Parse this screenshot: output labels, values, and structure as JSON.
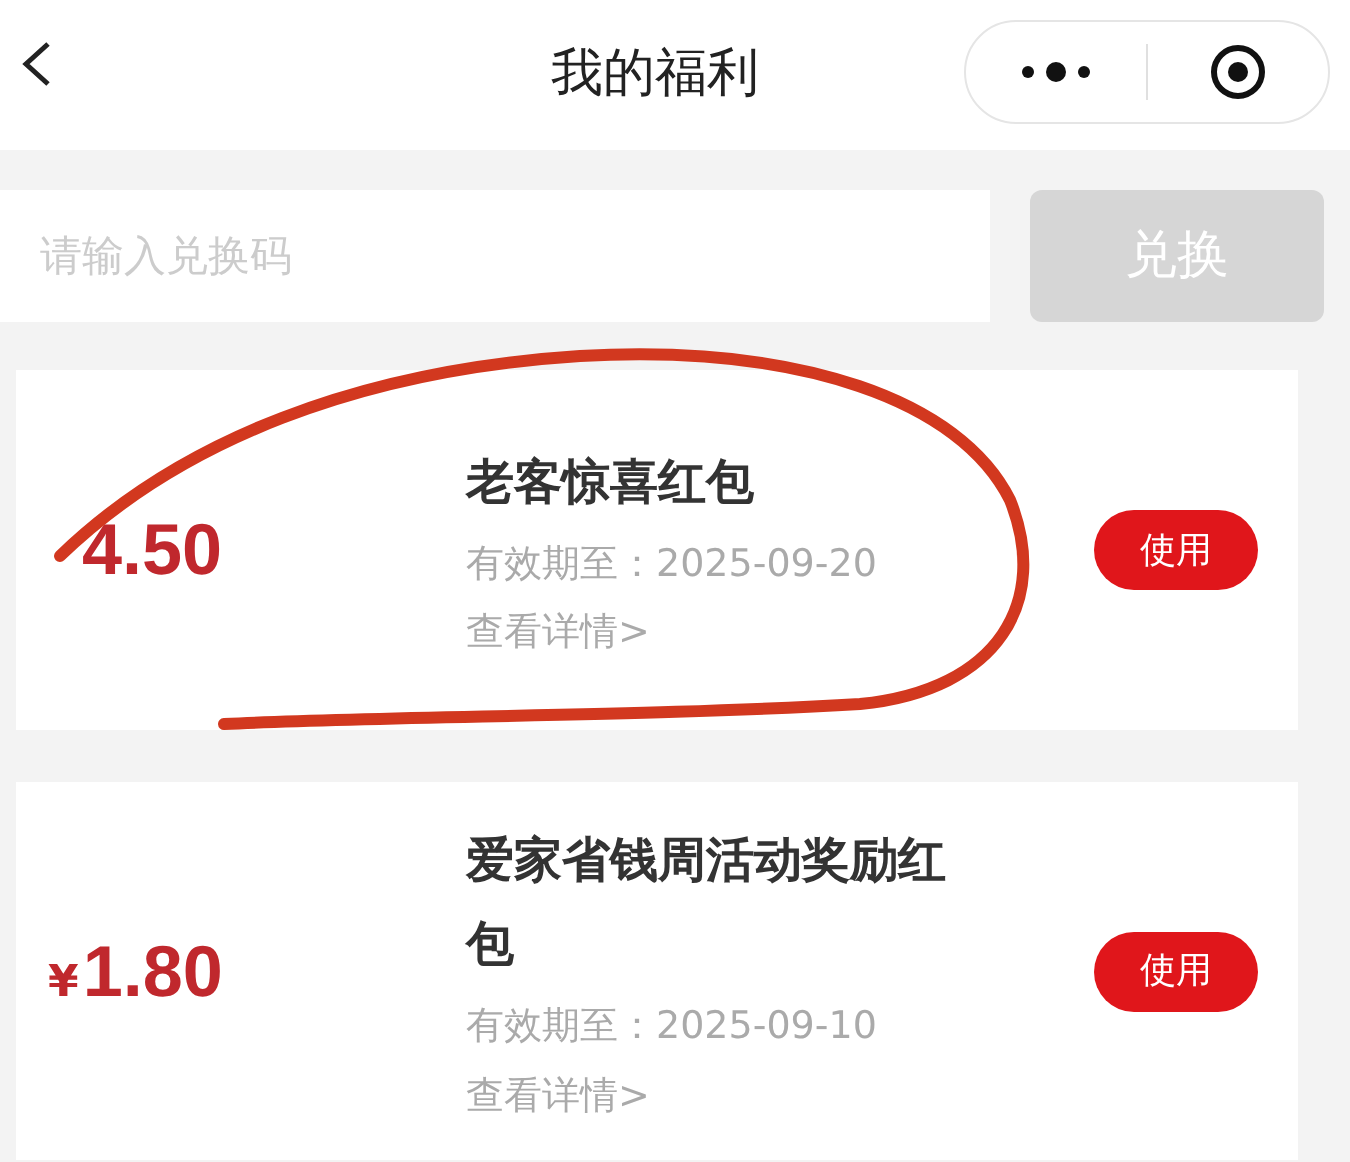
{
  "header": {
    "title": "我的福利"
  },
  "redeem": {
    "placeholder": "请输入兑换码",
    "button": "兑换",
    "disabled": true
  },
  "coupons": [
    {
      "amount": "4.50",
      "title": "老客惊喜红包",
      "expiry": "有效期至：2025-09-20",
      "details": "查看详情>",
      "action": "使用"
    },
    {
      "currency": "¥",
      "amount": "1.80",
      "title": "爱家省钱周活动奖励红包",
      "expiry": "有效期至：2025-09-10",
      "details": "查看详情>",
      "action": "使用"
    }
  ]
}
